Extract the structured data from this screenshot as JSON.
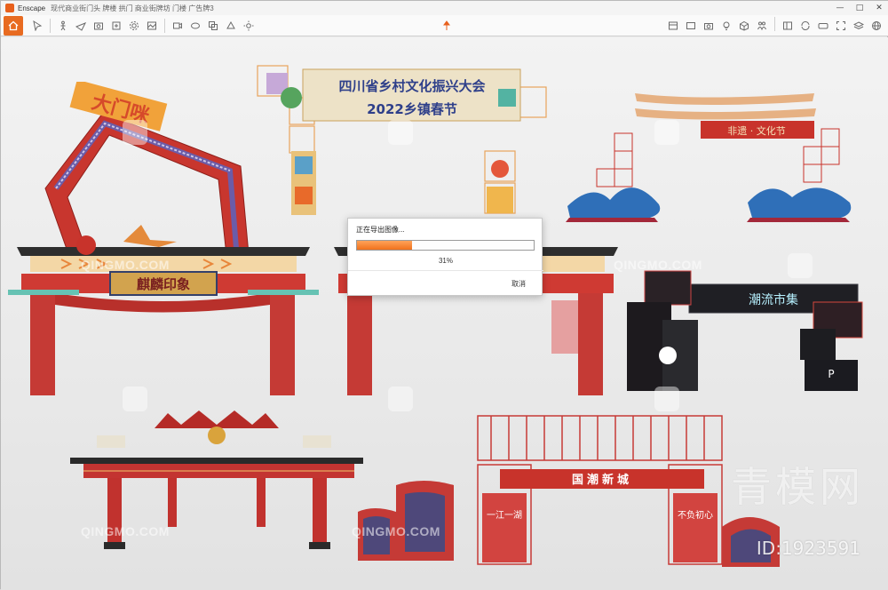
{
  "window": {
    "app_name": "Enscape",
    "document_title": "现代商业街门头 牌楼 拱门 商业街牌坊 门楼 广告牌3",
    "controls": {
      "minimize": "—",
      "maximize": "□",
      "close": "✕"
    }
  },
  "toolbar": {
    "left_icons": [
      "home-icon",
      "cursor-icon",
      "walk-icon",
      "fly-icon",
      "screenshot-icon",
      "export-icon",
      "settings-icon",
      "render-icon",
      "video-icon",
      "panorama-icon",
      "batch-icon",
      "material-icon",
      "sun-icon"
    ],
    "center_icon": "pin-icon",
    "right_icons": [
      "asset-library-icon",
      "view-icon",
      "camera-icon",
      "light-icon",
      "cube-icon",
      "people-icon",
      "panel-icon",
      "sync-icon",
      "vr-icon",
      "capture-icon",
      "layers-icon",
      "globe-icon"
    ]
  },
  "viewport": {
    "watermark_text": "QINGMO.COM",
    "brand_watermark": "青模网",
    "id_watermark": "ID:1923591",
    "models": [
      {
        "name": "arch-top-left",
        "sign": "大门咪"
      },
      {
        "name": "arch-top-center",
        "sign_line1": "四川省乡村文化振兴大会",
        "sign_line2": "2022乡镇春节"
      },
      {
        "name": "arch-top-right",
        "sign": "非遗 · 文化节"
      },
      {
        "name": "arch-mid-left",
        "sign": "麒麟印象"
      },
      {
        "name": "arch-mid-right",
        "sign": "潮流市集"
      },
      {
        "name": "arch-bottom-right",
        "sign": "国潮新城",
        "pillar_left": "一江一湖",
        "pillar_right": "不负初心"
      }
    ]
  },
  "export_dialog": {
    "title": "正在导出图像...",
    "progress": 31,
    "progress_label": "31%",
    "cancel_label": "取消"
  }
}
